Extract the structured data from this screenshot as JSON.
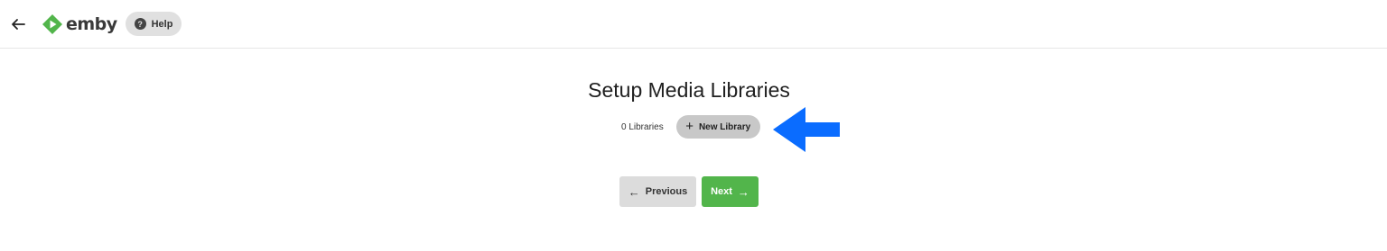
{
  "header": {
    "back_icon": "arrow-left-icon",
    "logo_text": "emby",
    "logo_color": "#52b54b",
    "help_label": "Help",
    "help_icon": "question-circle-icon"
  },
  "main": {
    "title": "Setup Media Libraries",
    "library_count": "0 Libraries",
    "new_library_label": "New Library",
    "new_library_icon": "plus-icon",
    "annotation_arrow_color": "#0a6cff"
  },
  "footer": {
    "previous_label": "Previous",
    "previous_icon": "arrow-left-icon",
    "next_label": "Next",
    "next_icon": "arrow-right-icon",
    "next_color": "#52b54b"
  }
}
